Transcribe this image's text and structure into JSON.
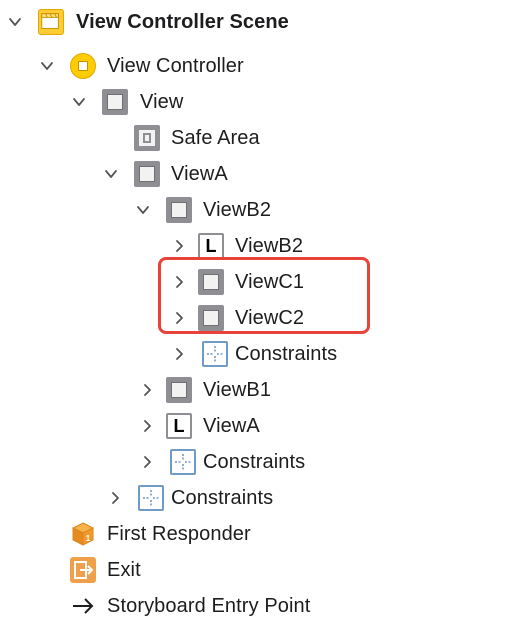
{
  "tree": {
    "scene": {
      "label": "View Controller Scene"
    },
    "view_controller": {
      "label": "View Controller"
    },
    "view": {
      "label": "View"
    },
    "safe_area": {
      "label": "Safe Area"
    },
    "viewA": {
      "label": "ViewA"
    },
    "viewB2": {
      "label": "ViewB2"
    },
    "viewB2_label": {
      "label": "ViewB2",
      "icon_glyph": "L"
    },
    "viewC1": {
      "label": "ViewC1"
    },
    "viewC2": {
      "label": "ViewC2"
    },
    "viewB2_constraints": {
      "label": "Constraints"
    },
    "viewB1": {
      "label": "ViewB1"
    },
    "viewA_label": {
      "label": "ViewA",
      "icon_glyph": "L"
    },
    "viewA_constraints": {
      "label": "Constraints"
    },
    "view_constraints": {
      "label": "Constraints"
    },
    "first_responder": {
      "label": "First Responder"
    },
    "exit": {
      "label": "Exit"
    },
    "entry_point": {
      "label": "Storyboard Entry Point"
    }
  },
  "colors": {
    "highlight": "#e8433a",
    "constraint_blue": "#6f9bc8",
    "view_gray": "#8e8e93",
    "controller_yellow": "#ffcc00",
    "exit_orange": "#f0a04b"
  },
  "icons": {
    "scene": "storyboard-scene-icon",
    "view_controller": "view-controller-icon",
    "view": "view-icon",
    "safe_area": "safe-area-icon",
    "label": "label-icon",
    "constraints": "constraints-icon",
    "first_responder": "first-responder-cube-icon",
    "exit": "exit-icon",
    "entry_point": "arrow-right-icon"
  }
}
